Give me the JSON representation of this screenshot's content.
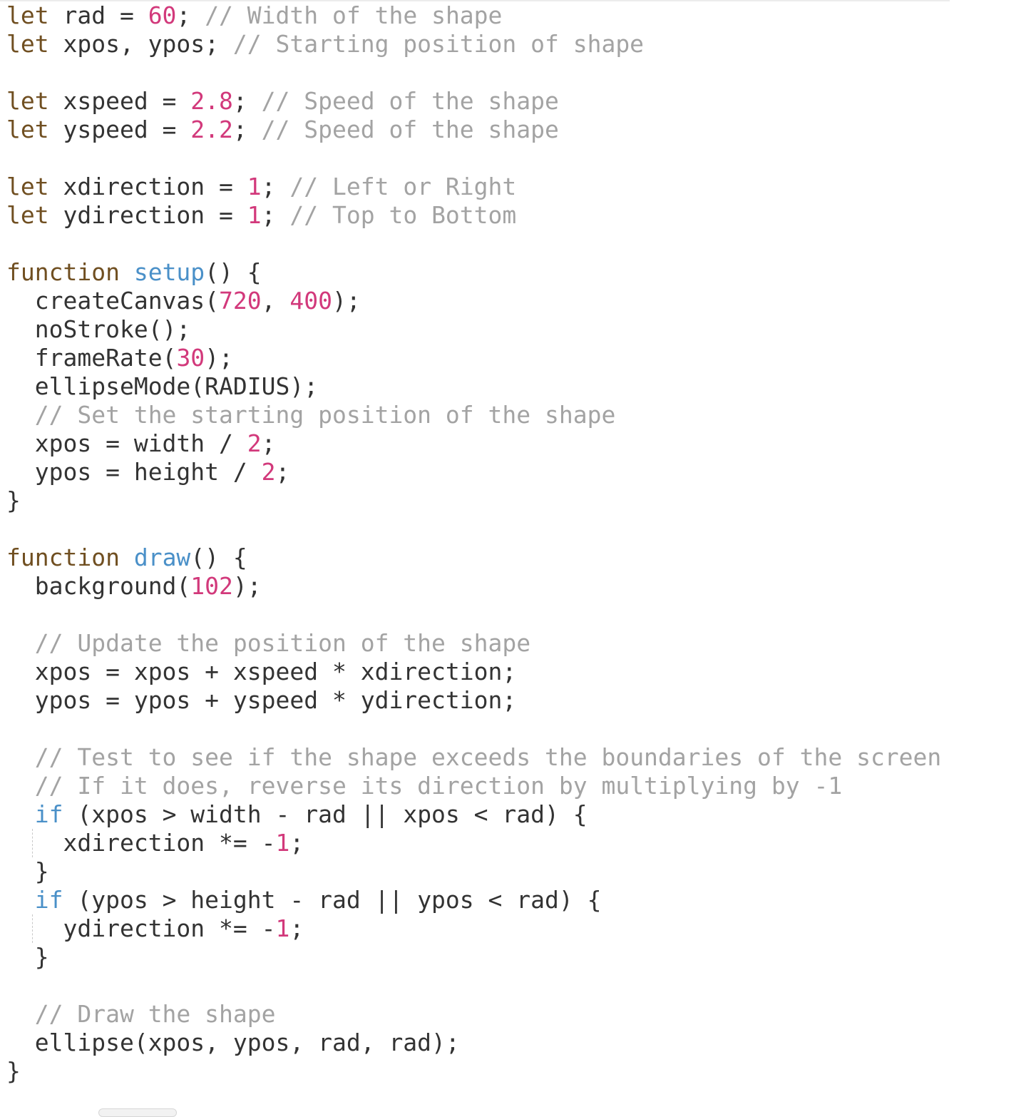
{
  "editor": {
    "lines": [
      {
        "indent": 0,
        "tokens": [
          {
            "t": "let",
            "k": "keyword"
          },
          {
            "t": " rad = ",
            "k": "plain"
          },
          {
            "t": "60",
            "k": "number"
          },
          {
            "t": "; ",
            "k": "plain"
          },
          {
            "t": "// Width of the shape",
            "k": "comment"
          }
        ]
      },
      {
        "indent": 0,
        "tokens": [
          {
            "t": "let",
            "k": "keyword"
          },
          {
            "t": " xpos, ypos; ",
            "k": "plain"
          },
          {
            "t": "// Starting position of shape",
            "k": "comment"
          }
        ]
      },
      {
        "indent": 0,
        "tokens": []
      },
      {
        "indent": 0,
        "tokens": [
          {
            "t": "let",
            "k": "keyword"
          },
          {
            "t": " xspeed = ",
            "k": "plain"
          },
          {
            "t": "2.8",
            "k": "number"
          },
          {
            "t": "; ",
            "k": "plain"
          },
          {
            "t": "// Speed of the shape",
            "k": "comment"
          }
        ]
      },
      {
        "indent": 0,
        "tokens": [
          {
            "t": "let",
            "k": "keyword"
          },
          {
            "t": " yspeed = ",
            "k": "plain"
          },
          {
            "t": "2.2",
            "k": "number"
          },
          {
            "t": "; ",
            "k": "plain"
          },
          {
            "t": "// Speed of the shape",
            "k": "comment"
          }
        ]
      },
      {
        "indent": 0,
        "tokens": []
      },
      {
        "indent": 0,
        "tokens": [
          {
            "t": "let",
            "k": "keyword"
          },
          {
            "t": " xdirection = ",
            "k": "plain"
          },
          {
            "t": "1",
            "k": "number"
          },
          {
            "t": "; ",
            "k": "plain"
          },
          {
            "t": "// Left or Right",
            "k": "comment"
          }
        ]
      },
      {
        "indent": 0,
        "tokens": [
          {
            "t": "let",
            "k": "keyword"
          },
          {
            "t": " ydirection = ",
            "k": "plain"
          },
          {
            "t": "1",
            "k": "number"
          },
          {
            "t": "; ",
            "k": "plain"
          },
          {
            "t": "// Top to Bottom",
            "k": "comment"
          }
        ]
      },
      {
        "indent": 0,
        "tokens": []
      },
      {
        "indent": 0,
        "tokens": [
          {
            "t": "function",
            "k": "keyword"
          },
          {
            "t": " ",
            "k": "plain"
          },
          {
            "t": "setup",
            "k": "fn"
          },
          {
            "t": "() {",
            "k": "plain"
          }
        ]
      },
      {
        "indent": 1,
        "tokens": [
          {
            "t": "createCanvas(",
            "k": "plain"
          },
          {
            "t": "720",
            "k": "number"
          },
          {
            "t": ", ",
            "k": "plain"
          },
          {
            "t": "400",
            "k": "number"
          },
          {
            "t": ");",
            "k": "plain"
          }
        ]
      },
      {
        "indent": 1,
        "tokens": [
          {
            "t": "noStroke();",
            "k": "plain"
          }
        ]
      },
      {
        "indent": 1,
        "tokens": [
          {
            "t": "frameRate(",
            "k": "plain"
          },
          {
            "t": "30",
            "k": "number"
          },
          {
            "t": ");",
            "k": "plain"
          }
        ]
      },
      {
        "indent": 1,
        "tokens": [
          {
            "t": "ellipseMode(RADIUS);",
            "k": "plain"
          }
        ]
      },
      {
        "indent": 1,
        "tokens": [
          {
            "t": "// Set the starting position of the shape",
            "k": "comment"
          }
        ]
      },
      {
        "indent": 1,
        "tokens": [
          {
            "t": "xpos = width / ",
            "k": "plain"
          },
          {
            "t": "2",
            "k": "number"
          },
          {
            "t": ";",
            "k": "plain"
          }
        ]
      },
      {
        "indent": 1,
        "tokens": [
          {
            "t": "ypos = height / ",
            "k": "plain"
          },
          {
            "t": "2",
            "k": "number"
          },
          {
            "t": ";",
            "k": "plain"
          }
        ]
      },
      {
        "indent": 0,
        "tokens": [
          {
            "t": "}",
            "k": "plain"
          }
        ]
      },
      {
        "indent": 0,
        "tokens": []
      },
      {
        "indent": 0,
        "tokens": [
          {
            "t": "function",
            "k": "keyword"
          },
          {
            "t": " ",
            "k": "plain"
          },
          {
            "t": "draw",
            "k": "fn"
          },
          {
            "t": "() {",
            "k": "plain"
          }
        ]
      },
      {
        "indent": 1,
        "tokens": [
          {
            "t": "background(",
            "k": "plain"
          },
          {
            "t": "102",
            "k": "number"
          },
          {
            "t": ");",
            "k": "plain"
          }
        ]
      },
      {
        "indent": 0,
        "tokens": []
      },
      {
        "indent": 1,
        "tokens": [
          {
            "t": "// Update the position of the shape",
            "k": "comment"
          }
        ]
      },
      {
        "indent": 1,
        "tokens": [
          {
            "t": "xpos = xpos + xspeed * xdirection;",
            "k": "plain"
          }
        ]
      },
      {
        "indent": 1,
        "tokens": [
          {
            "t": "ypos = ypos + yspeed * ydirection;",
            "k": "plain"
          }
        ]
      },
      {
        "indent": 0,
        "tokens": []
      },
      {
        "indent": 1,
        "tokens": [
          {
            "t": "// Test to see if the shape exceeds the boundaries of the screen",
            "k": "comment"
          }
        ]
      },
      {
        "indent": 1,
        "tokens": [
          {
            "t": "// If it does, reverse its direction by multiplying by -1",
            "k": "comment"
          }
        ]
      },
      {
        "indent": 1,
        "tokens": [
          {
            "t": "if",
            "k": "fn"
          },
          {
            "t": " (xpos > width - rad || xpos < rad) {",
            "k": "plain"
          }
        ]
      },
      {
        "indent": 2,
        "guide": true,
        "tokens": [
          {
            "t": "xdirection *= -",
            "k": "plain"
          },
          {
            "t": "1",
            "k": "number"
          },
          {
            "t": ";",
            "k": "plain"
          }
        ]
      },
      {
        "indent": 1,
        "tokens": [
          {
            "t": "}",
            "k": "plain"
          }
        ]
      },
      {
        "indent": 1,
        "tokens": [
          {
            "t": "if",
            "k": "fn"
          },
          {
            "t": " (ypos > height - rad || ypos < rad) {",
            "k": "plain"
          }
        ]
      },
      {
        "indent": 2,
        "guide": true,
        "tokens": [
          {
            "t": "ydirection *= -",
            "k": "plain"
          },
          {
            "t": "1",
            "k": "number"
          },
          {
            "t": ";",
            "k": "plain"
          }
        ]
      },
      {
        "indent": 1,
        "tokens": [
          {
            "t": "}",
            "k": "plain"
          }
        ]
      },
      {
        "indent": 0,
        "tokens": []
      },
      {
        "indent": 1,
        "tokens": [
          {
            "t": "// Draw the shape",
            "k": "comment"
          }
        ]
      },
      {
        "indent": 1,
        "tokens": [
          {
            "t": "ellipse(xpos, ypos, rad, rad);",
            "k": "plain"
          }
        ]
      },
      {
        "indent": 0,
        "tokens": [
          {
            "t": "}",
            "k": "plain"
          }
        ]
      }
    ]
  },
  "theme": {
    "keyword": "#704f21",
    "function": "#4a90c8",
    "number": "#d2397b",
    "comment": "#a3a3a3",
    "text": "#333333"
  }
}
